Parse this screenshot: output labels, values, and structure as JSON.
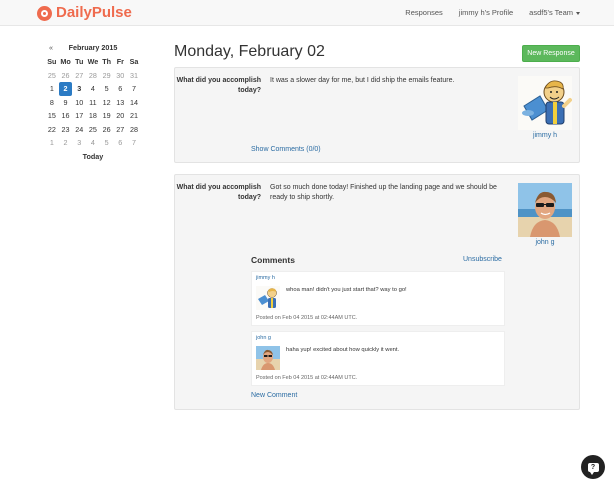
{
  "app": {
    "brand": "DailyPulse",
    "brand_color": "#ef6b4e"
  },
  "nav": {
    "responses": "Responses",
    "profile": "jimmy h's Profile",
    "team": "asdf5's Team"
  },
  "calendar": {
    "prev": "«",
    "month": "February 2015",
    "weekdays": [
      "Su",
      "Mo",
      "Tu",
      "We",
      "Th",
      "Fr",
      "Sa"
    ],
    "weeks": [
      [
        "25",
        "26",
        "27",
        "28",
        "29",
        "30",
        "31"
      ],
      [
        "1",
        "2",
        "3",
        "4",
        "5",
        "6",
        "7"
      ],
      [
        "8",
        "9",
        "10",
        "11",
        "12",
        "13",
        "14"
      ],
      [
        "15",
        "16",
        "17",
        "18",
        "19",
        "20",
        "21"
      ],
      [
        "22",
        "23",
        "24",
        "25",
        "26",
        "27",
        "28"
      ],
      [
        "1",
        "2",
        "3",
        "4",
        "5",
        "6",
        "7"
      ]
    ],
    "selected": "2",
    "today_label": "Today"
  },
  "main": {
    "date_title": "Monday, February 02",
    "new_response": "New Response"
  },
  "responses": [
    {
      "question": "What did you accomplish today?",
      "answer": "It was a slower day for me, but I did ship the emails feature.",
      "user": "jimmy h",
      "avatar": "vault-boy-trophy",
      "show_comments": "Show Comments (0/0)"
    },
    {
      "question": "What did you accomplish today?",
      "answer": "Got so much done today! Finished up the landing page and we should be ready to ship shortly.",
      "user": "john g",
      "avatar": "john-beach-photo",
      "comments_heading": "Comments",
      "unsubscribe": "Unsubscribe",
      "new_comment": "New Comment",
      "comments": [
        {
          "user": "jimmy h",
          "text": "whoa man! didn't you just start that? way to go!",
          "time": "Posted on Feb 04 2015 at 02:44AM UTC."
        },
        {
          "user": "john g",
          "text": "haha yup! excited about how quickly it went.",
          "time": "Posted on Feb 04 2015 at 02:44AM UTC."
        }
      ]
    }
  ],
  "help": {
    "label": "?"
  },
  "colors": {
    "link": "#2b6ca3",
    "button_green": "#5cb85c",
    "selected_day": "#2b7bc4"
  }
}
